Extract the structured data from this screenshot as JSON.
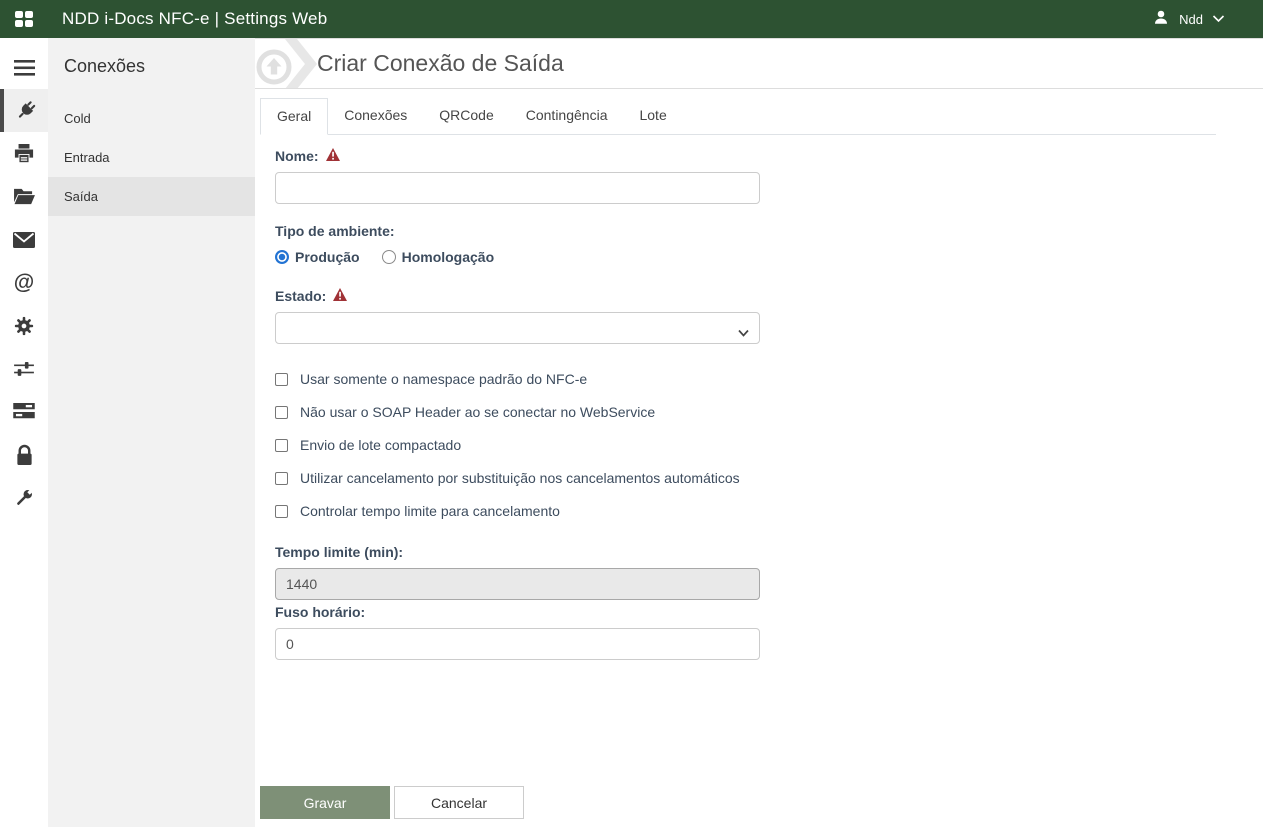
{
  "header": {
    "title": "NDD i-Docs NFC-e | Settings Web",
    "user_name": "Ndd",
    "bg_color": "#2d5232"
  },
  "rail": {
    "items": [
      {
        "icon": "menu-icon",
        "active": false
      },
      {
        "icon": "plug-icon",
        "active": true
      },
      {
        "icon": "printer-icon",
        "active": false
      },
      {
        "icon": "folder-open-icon",
        "active": false
      },
      {
        "icon": "envelope-icon",
        "active": false
      },
      {
        "icon": "at-sign-icon",
        "active": false
      },
      {
        "icon": "gear-icon",
        "active": false
      },
      {
        "icon": "sliders-icon",
        "active": false
      },
      {
        "icon": "server-icon",
        "active": false
      },
      {
        "icon": "lock-icon",
        "active": false
      },
      {
        "icon": "wrench-icon",
        "active": false
      }
    ]
  },
  "sidebar": {
    "title": "Conexões",
    "items": [
      {
        "label": "Cold",
        "selected": false
      },
      {
        "label": "Entrada",
        "selected": false
      },
      {
        "label": "Saída",
        "selected": true
      }
    ]
  },
  "main": {
    "page_title": "Criar Conexão de Saída",
    "title_icon": "upload-arrow-icon",
    "tabs": [
      {
        "label": "Geral",
        "active": true
      },
      {
        "label": "Conexões",
        "active": false
      },
      {
        "label": "QRCode",
        "active": false
      },
      {
        "label": "Contingência",
        "active": false
      },
      {
        "label": "Lote",
        "active": false
      }
    ],
    "form": {
      "nome": {
        "label": "Nome:",
        "required": true,
        "value": ""
      },
      "tipo_ambiente": {
        "label": "Tipo de ambiente:",
        "options": [
          {
            "label": "Produção",
            "selected": true
          },
          {
            "label": "Homologação",
            "selected": false
          }
        ]
      },
      "estado": {
        "label": "Estado:",
        "required": true,
        "value": ""
      },
      "checkboxes": [
        {
          "label": "Usar somente o namespace padrão do NFC-e",
          "checked": false
        },
        {
          "label": "Não usar o SOAP Header ao se conectar no WebService",
          "checked": false
        },
        {
          "label": "Envio de lote compactado",
          "checked": false
        },
        {
          "label": "Utilizar cancelamento por substituição nos cancelamentos automáticos",
          "checked": false
        },
        {
          "label": "Controlar tempo limite para cancelamento",
          "checked": false
        }
      ],
      "tempo_limite": {
        "label": "Tempo limite (min):",
        "value": "1440",
        "disabled": true
      },
      "fuso_horario": {
        "label": "Fuso horário:",
        "value": "0"
      }
    },
    "actions": {
      "save_label": "Gravar",
      "cancel_label": "Cancelar"
    }
  },
  "colors": {
    "header_green": "#2d5232",
    "save_button_green": "#7e9077",
    "warning_red": "#a03236",
    "radio_blue": "#2273d3",
    "label_navy": "#3d4c5e",
    "sidebar_gray": "#f2f2f2",
    "sidebar_selected_gray": "#e4e4e4"
  }
}
